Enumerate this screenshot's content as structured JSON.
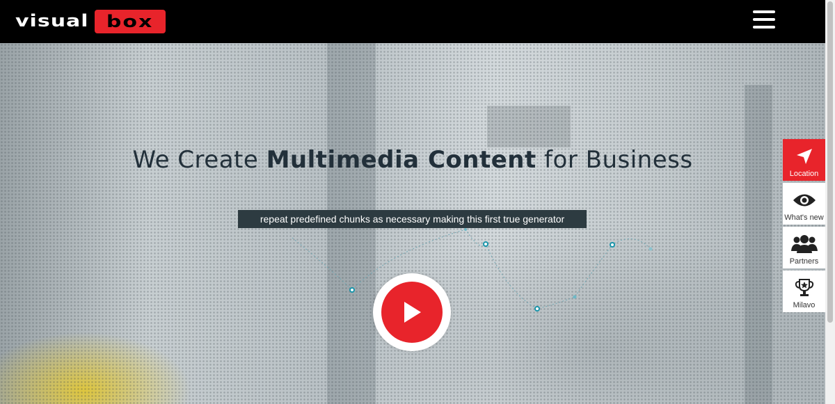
{
  "header": {
    "logo_word": "visual",
    "logo_box": "box",
    "menu_icon": "hamburger-menu-icon"
  },
  "hero": {
    "headline_pre": "We Create ",
    "headline_bold": "Multimedia Content",
    "headline_post": " for Business",
    "tagline": "repeat predefined chunks as necessary making this first true generator",
    "play_icon": "play-icon"
  },
  "side_menu": {
    "items": [
      {
        "label": "Location",
        "icon": "navigation-arrow-icon",
        "active": true
      },
      {
        "label": "What's new",
        "icon": "eye-icon",
        "active": false
      },
      {
        "label": "Partners",
        "icon": "people-group-icon",
        "active": false
      },
      {
        "label": "Milavo",
        "icon": "trophy-icon",
        "active": false
      }
    ]
  },
  "colors": {
    "brand_red": "#e8242b",
    "header_bg": "#000000",
    "tagline_bg": "#2d3b41",
    "headline_text": "#22303a"
  }
}
